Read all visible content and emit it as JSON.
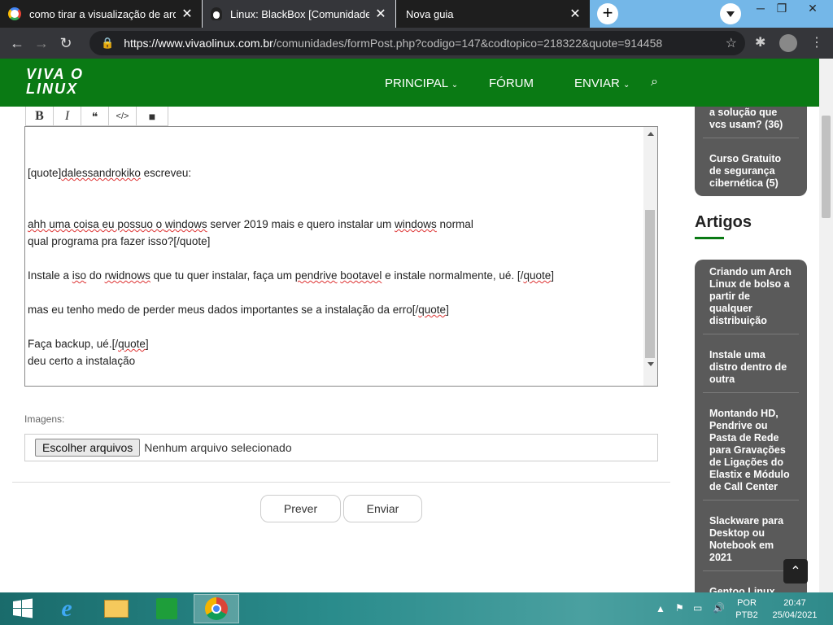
{
  "browser": {
    "tabs": [
      {
        "title": "como tirar a visualização de arqu",
        "active": false,
        "icon": "google-icon"
      },
      {
        "title": "Linux: BlackBox [Comunidade]",
        "active": true,
        "icon": "tux-icon"
      },
      {
        "title": "Nova guia",
        "active": false,
        "icon": ""
      }
    ],
    "url_prefix": "https://",
    "url_host": "www.vivaolinux.com.br",
    "url_path": "/comunidades/formPost.php?codigo=147&codtopico=218322&quote=914458"
  },
  "site": {
    "logo_line1": "VIVA O",
    "logo_line2": "LINUX",
    "nav": {
      "principal": "PRINCIPAL",
      "forum": "FÓRUM",
      "enviar": "ENVIAR"
    },
    "brand_color": "#0a7a14"
  },
  "editor": {
    "toolbar": {
      "bold": "B",
      "italic": "I",
      "quote": "❝",
      "code": "</>",
      "video": "■"
    },
    "content": {
      "l1a": "[quote]",
      "l1b": "dalessandrokiko",
      "l1c": " escreveu:",
      "l2a": "ahh uma coisa eu possuo o ",
      "l2b": "windows",
      "l2c": " server 2019 mais e quero instalar um ",
      "l2d": "windows",
      "l2e": " normal",
      "l3": "qual programa pra fazer isso?[/quote]",
      "l4a": "Instale a ",
      "l4b": "iso",
      "l4c": " do ",
      "l4d": "rwidnows",
      "l4e": " que tu quer instalar, faça um ",
      "l4f": "pendrive",
      "l4g": " ",
      "l4h": "bootavel",
      "l4i": " e instale normalmente, ué. [/",
      "l4j": "quote",
      "l4k": "]",
      "l5a": "mas eu tenho medo de perder meus dados importantes se a instalação da erro[/",
      "l5b": "quote",
      "l5c": "]",
      "l6a": "Faça backup, ué.[/",
      "l6b": "quote",
      "l6c": "]",
      "l7": "deu certo a instalação"
    }
  },
  "images": {
    "label": "Imagens:",
    "choose_button": "Escolher arquivos",
    "status": "Nenhum arquivo selecionado"
  },
  "actions": {
    "preview": "Prever",
    "send": "Enviar"
  },
  "sidebar": {
    "top_items": [
      {
        "lines": [
          "a solução que",
          "vcs usam? (36)"
        ]
      },
      {
        "lines": [
          "Curso Gratuito",
          "de segurança",
          "cibernética (5)"
        ]
      }
    ],
    "artigos_title": "Artigos",
    "artigos": [
      {
        "lines": [
          "Criando um Arch",
          "Linux de bolso a",
          "partir de",
          "qualquer",
          "distribuição"
        ]
      },
      {
        "lines": [
          "Instale uma",
          "distro dentro de",
          "outra"
        ]
      },
      {
        "lines": [
          "Montando HD,",
          "Pendrive ou",
          "Pasta de Rede",
          "para Gravações",
          "de Ligações do",
          "Elastix e Módulo",
          "de Call Center"
        ]
      },
      {
        "lines": [
          "Slackware para",
          "Desktop ou",
          "Notebook em",
          "2021"
        ]
      },
      {
        "lines": [
          "Gentoo Linux"
        ]
      }
    ]
  },
  "taskbar": {
    "lang_top": "POR",
    "lang_bottom": "PTB2",
    "time": "20:47",
    "date": "25/04/2021"
  }
}
